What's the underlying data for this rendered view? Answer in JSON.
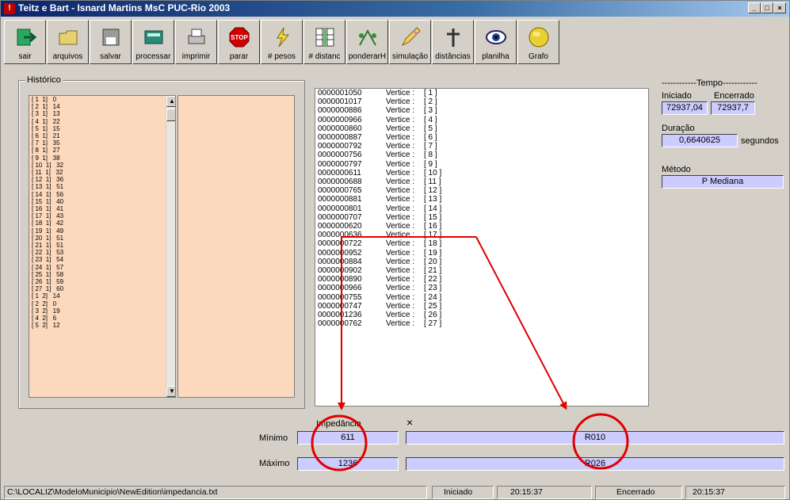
{
  "window": {
    "title": "Teitz e Bart  -  Isnard Martins MsC PUC-Rio 2003"
  },
  "toolbar": [
    {
      "label": "sair",
      "icon": "exit-icon"
    },
    {
      "label": "arquivos",
      "icon": "folder-icon"
    },
    {
      "label": "salvar",
      "icon": "floppy-icon"
    },
    {
      "label": "processar",
      "icon": "calculator-icon"
    },
    {
      "label": "imprimir",
      "icon": "printer-icon"
    },
    {
      "label": "parar",
      "icon": "stop-icon",
      "icon_text": "STOP"
    },
    {
      "label": "# pesos",
      "icon": "lightning-icon"
    },
    {
      "label": "# distanc",
      "icon": "grid-icon"
    },
    {
      "label": "ponderarH",
      "icon": "weights-icon"
    },
    {
      "label": "simulação",
      "icon": "pencil-icon"
    },
    {
      "label": "distâncias",
      "icon": "cross-icon"
    },
    {
      "label": "planilha",
      "icon": "eye-icon"
    },
    {
      "label": "Grafo",
      "icon": "globe-icon"
    }
  ],
  "historico": {
    "legend": "Histórico",
    "rows": [
      "[ 1  1]   0",
      "[ 2  1]   14",
      "[ 3  1]   13",
      "[ 4  1]   22",
      "[ 5  1]   15",
      "[ 6  1]   21",
      "[ 7  1]   35",
      "[ 8  1]   27",
      "[ 9  1]   38",
      "[ 10  1]   32",
      "[ 11  1]   32",
      "[ 12  1]   36",
      "[ 13  1]   51",
      "[ 14  1]   56",
      "[ 15  1]   40",
      "[ 16  1]   41",
      "[ 17  1]   43",
      "[ 18  1]   42",
      "[ 19  1]   49",
      "[ 20  1]   51",
      "[ 21  1]   51",
      "[ 22  1]   53",
      "[ 23  1]   54",
      "[ 24  1]   57",
      "[ 25  1]   58",
      "[ 26  1]   59",
      "[ 27  1]   60",
      "[ 1  2]   14",
      "[ 2  2]   0",
      "[ 3  2]   19",
      "[ 4  2]   6",
      "[ 5  2]   12"
    ]
  },
  "vertices": [
    {
      "code": "0000001050",
      "label": "Vertice :",
      "idx": "[  1 ]"
    },
    {
      "code": "0000001017",
      "label": "Vertice :",
      "idx": "[  2 ]"
    },
    {
      "code": "0000000886",
      "label": "Vertice :",
      "idx": "[  3 ]"
    },
    {
      "code": "0000000966",
      "label": "Vertice :",
      "idx": "[  4 ]"
    },
    {
      "code": "0000000860",
      "label": "Vertice :",
      "idx": "[  5 ]"
    },
    {
      "code": "0000000887",
      "label": "Vertice :",
      "idx": "[  6 ]"
    },
    {
      "code": "0000000792",
      "label": "Vertice :",
      "idx": "[  7 ]"
    },
    {
      "code": "0000000756",
      "label": "Vertice :",
      "idx": "[  8 ]"
    },
    {
      "code": "0000000797",
      "label": "Vertice :",
      "idx": "[  9 ]"
    },
    {
      "code": "0000000611",
      "label": "Vertice :",
      "idx": "[  10 ]"
    },
    {
      "code": "0000000688",
      "label": "Vertice :",
      "idx": "[  11 ]"
    },
    {
      "code": "0000000765",
      "label": "Vertice :",
      "idx": "[  12 ]"
    },
    {
      "code": "0000000881",
      "label": "Vertice :",
      "idx": "[  13 ]"
    },
    {
      "code": "0000000801",
      "label": "Vertice :",
      "idx": "[  14 ]"
    },
    {
      "code": "0000000707",
      "label": "Vertice :",
      "idx": "[  15 ]"
    },
    {
      "code": "0000000620",
      "label": "Vertice :",
      "idx": "[  16 ]"
    },
    {
      "code": "0000000636",
      "label": "Vertice :",
      "idx": "[  17 ]"
    },
    {
      "code": "0000000722",
      "label": "Vertice :",
      "idx": "[  18 ]"
    },
    {
      "code": "0000000952",
      "label": "Vertice :",
      "idx": "[  19 ]"
    },
    {
      "code": "0000000884",
      "label": "Vertice :",
      "idx": "[  20 ]"
    },
    {
      "code": "0000000902",
      "label": "Vertice :",
      "idx": "[  21 ]"
    },
    {
      "code": "0000000890",
      "label": "Vertice :",
      "idx": "[  22 ]"
    },
    {
      "code": "0000000966",
      "label": "Vertice :",
      "idx": "[  23 ]"
    },
    {
      "code": "0000000755",
      "label": "Vertice :",
      "idx": "[  24 ]"
    },
    {
      "code": "0000000747",
      "label": "Vertice :",
      "idx": "[  25 ]"
    },
    {
      "code": "0000001236",
      "label": "Vertice :",
      "idx": "[  26 ]"
    },
    {
      "code": "0000000762",
      "label": "Vertice :",
      "idx": "[  27 ]"
    }
  ],
  "tempo": {
    "title": "------------Tempo------------",
    "iniciado_label": "Iniciado",
    "encerrado_label": "Encerrado",
    "iniciado": "72937,04",
    "encerrado": "72937,7",
    "duracao_label": "Duração",
    "duracao": "0,6640625",
    "segundos": "segundos",
    "metodo_label": "Método",
    "metodo": "P Mediana"
  },
  "result": {
    "impedancia_label": "Impedância",
    "x_label": "×",
    "minimo_label": "Mínimo",
    "maximo_label": "Máximo",
    "minimo_value": "611",
    "minimo_id": "R010",
    "maximo_value": "1236",
    "maximo_id": "R026"
  },
  "statusbar": {
    "path": "C:\\LOCALIZ\\ModeloMunicipio\\NewEdition\\impedancia.txt",
    "iniciado_label": "Iniciado",
    "iniciado_time": "20:15:37",
    "encerrado_label": "Encerrado",
    "encerrado_time": "20:15:37"
  },
  "colors": {
    "annotation": "#e00000",
    "field": "#ccccff",
    "list": "#fcd9bd"
  }
}
